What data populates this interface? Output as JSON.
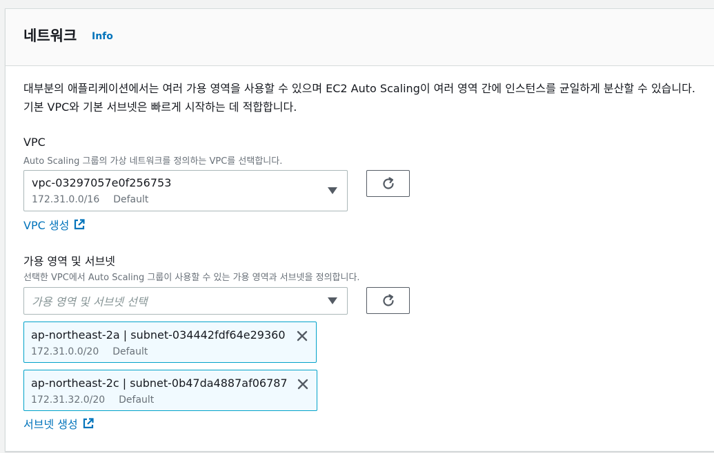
{
  "header": {
    "title": "네트워크",
    "info_label": "Info"
  },
  "description": "대부분의 애플리케이션에서는 여러 가용 영역을 사용할 수 있으며 EC2 Auto Scaling이 여러 영역 간에 인스턴스를 균일하게 분산할 수 있습니다. 기본 VPC와 기본 서브넷은 빠르게 시작하는 데 적합합니다.",
  "vpc": {
    "label": "VPC",
    "hint": "Auto Scaling 그룹의 가상 네트워크를 정의하는 VPC를 선택합니다.",
    "selected_id": "vpc-03297057e0f256753",
    "selected_cidr": "172.31.0.0/16",
    "selected_tag": "Default",
    "create_link": "VPC 생성"
  },
  "subnets": {
    "label": "가용 영역 및 서브넷",
    "hint": "선택한 VPC에서 Auto Scaling 그룹이 사용할 수 있는 가용 영역과 서브넷을 정의합니다.",
    "placeholder": "가용 영역 및 서브넷 선택",
    "tokens": [
      {
        "name": "ap-northeast-2a | subnet-034442fdf64e29360",
        "cidr": "172.31.0.0/20",
        "tag": "Default"
      },
      {
        "name": "ap-northeast-2c | subnet-0b47da4887af06787",
        "cidr": "172.31.32.0/20",
        "tag": "Default"
      }
    ],
    "create_link": "서브넷 생성"
  },
  "icons": {
    "refresh": "refresh-icon",
    "caret": "caret-down-icon",
    "external": "external-link-icon",
    "dismiss": "close-icon"
  },
  "colors": {
    "link": "#0073bb",
    "token_border": "#00a1c9",
    "token_bg": "#f1faff"
  }
}
